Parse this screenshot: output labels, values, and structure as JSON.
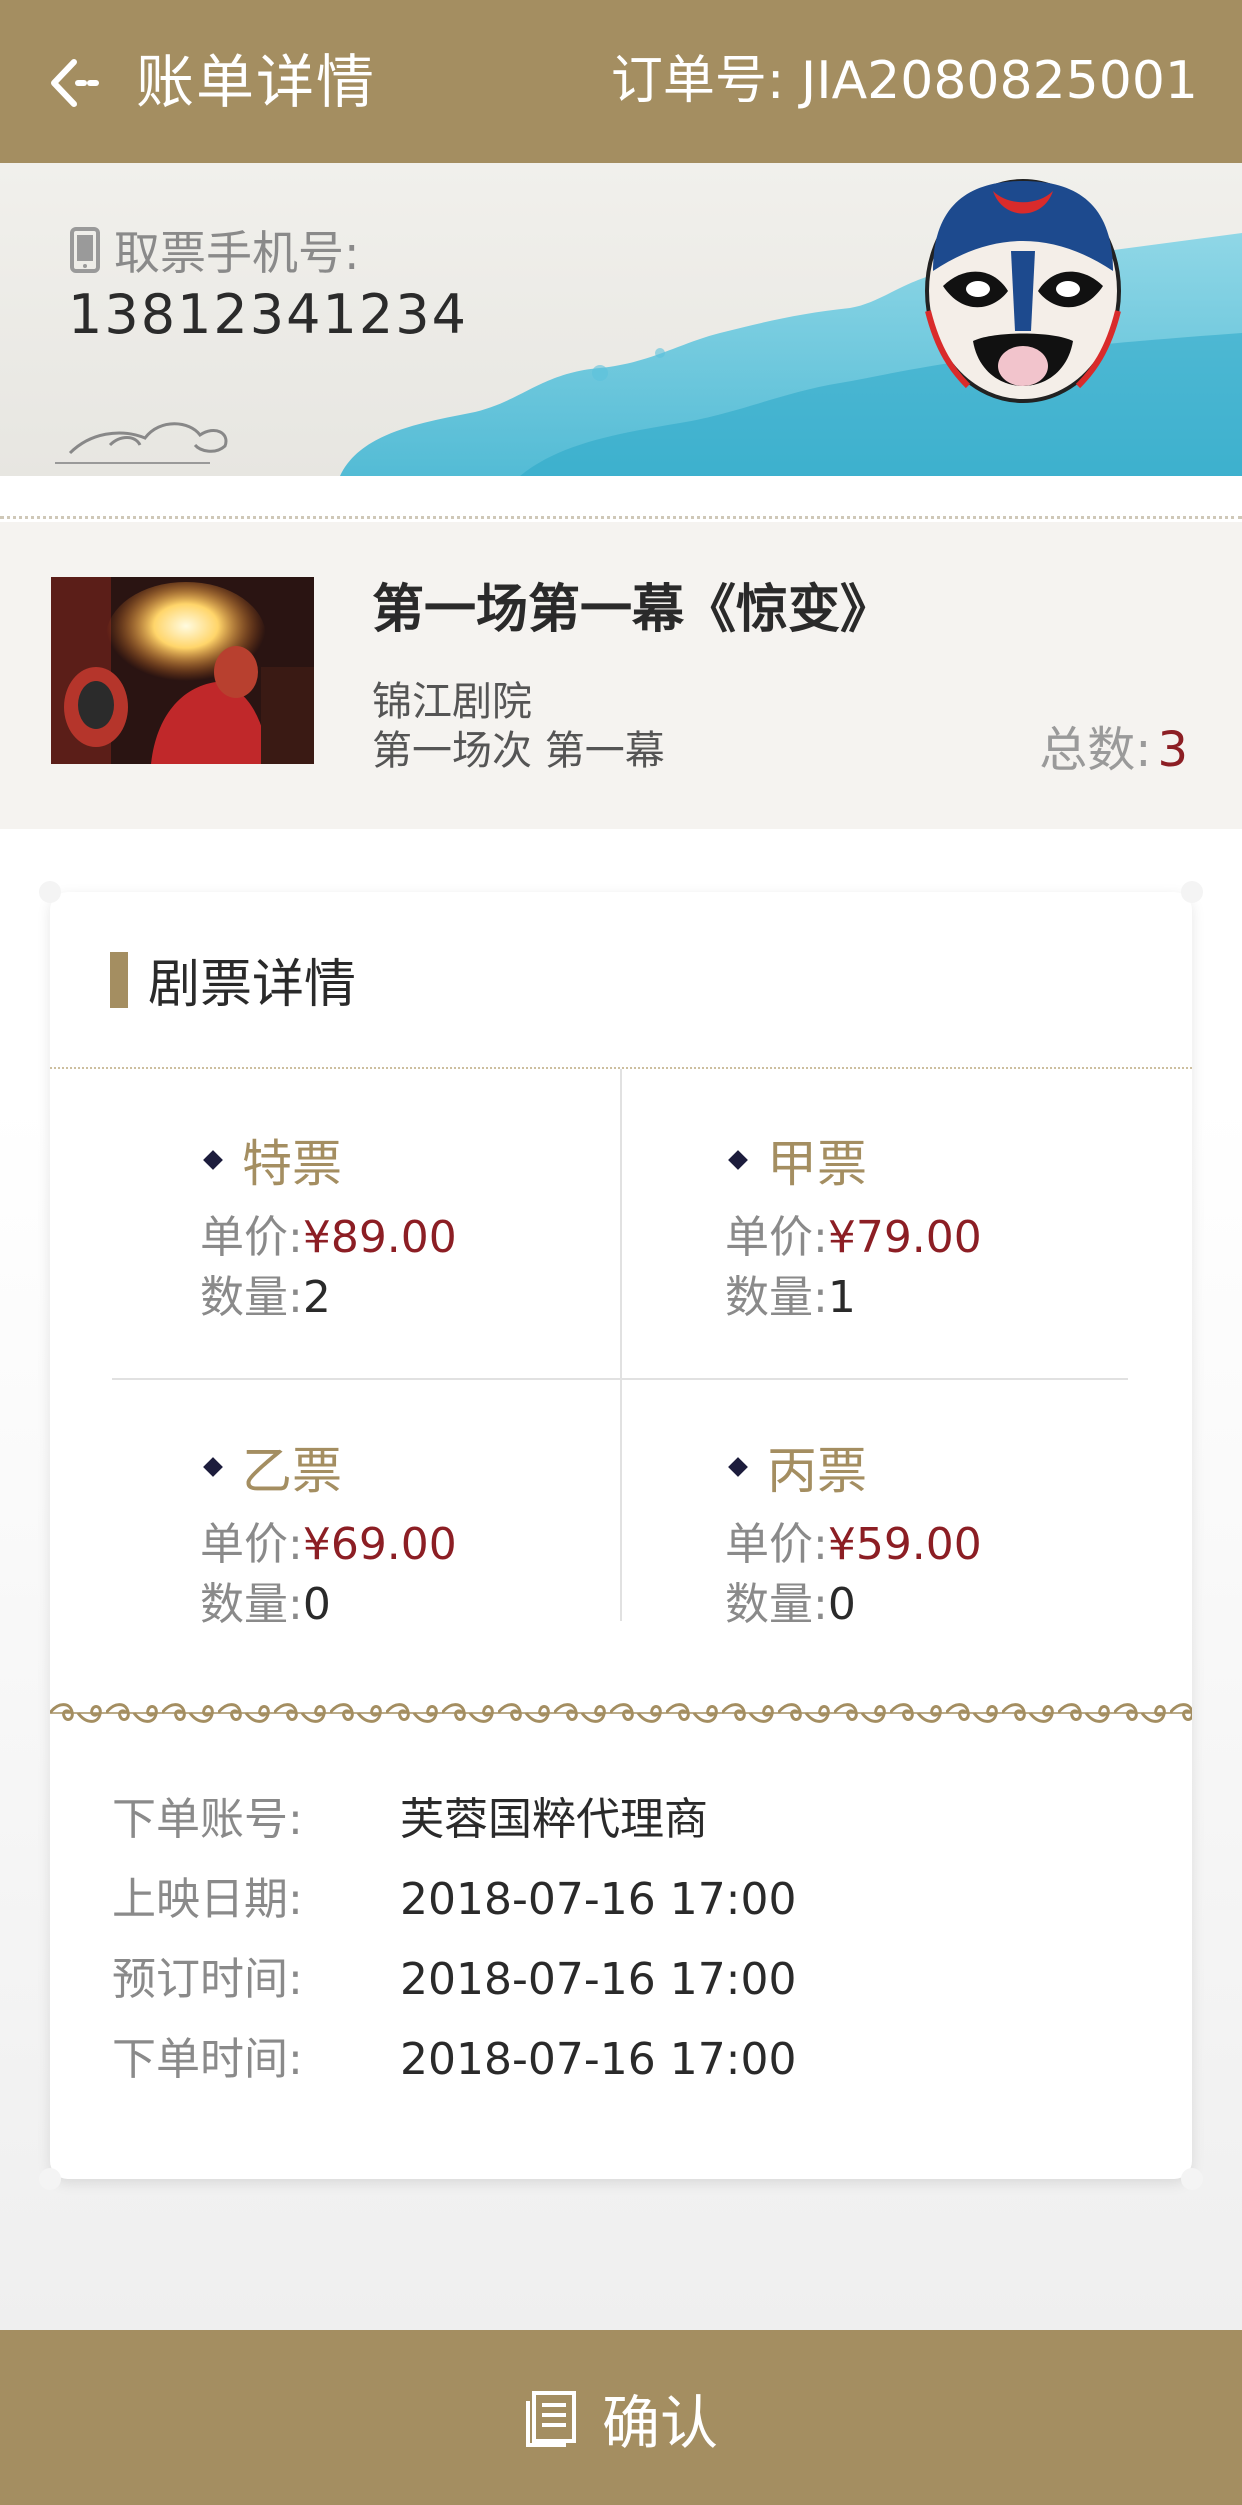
{
  "header": {
    "title": "账单详情",
    "order_label": "订单号:",
    "order_number": "JIA2080825001"
  },
  "banner": {
    "phone_label": "取票手机号:",
    "phone_number": "13812341234"
  },
  "show": {
    "title": "第一场第一幕《惊变》",
    "venue": "锦江剧院",
    "session": "第一场次 第一幕",
    "total_label": "总数:",
    "total_value": "3"
  },
  "ticket_details": {
    "title": "剧票详情",
    "price_label": "单价:",
    "qty_label": "数量:",
    "tickets": [
      {
        "name": "特票",
        "price": "¥89.00",
        "qty": "2"
      },
      {
        "name": "甲票",
        "price": "¥79.00",
        "qty": "1"
      },
      {
        "name": "乙票",
        "price": "¥69.00",
        "qty": "0"
      },
      {
        "name": "丙票",
        "price": "¥59.00",
        "qty": "0"
      }
    ]
  },
  "order_info": [
    {
      "label": "下单账号:",
      "value": "芙蓉国粹代理商"
    },
    {
      "label": "上映日期:",
      "value": "2018-07-16 17:00"
    },
    {
      "label": "预订时间:",
      "value": "2018-07-16 17:00"
    },
    {
      "label": "下单时间:",
      "value": "2018-07-16 17:00"
    }
  ],
  "footer": {
    "confirm_label": "确认"
  },
  "colors": {
    "brand": "#a48e61",
    "price": "#8c1e24",
    "accent_dark": "#1c1c3c"
  }
}
